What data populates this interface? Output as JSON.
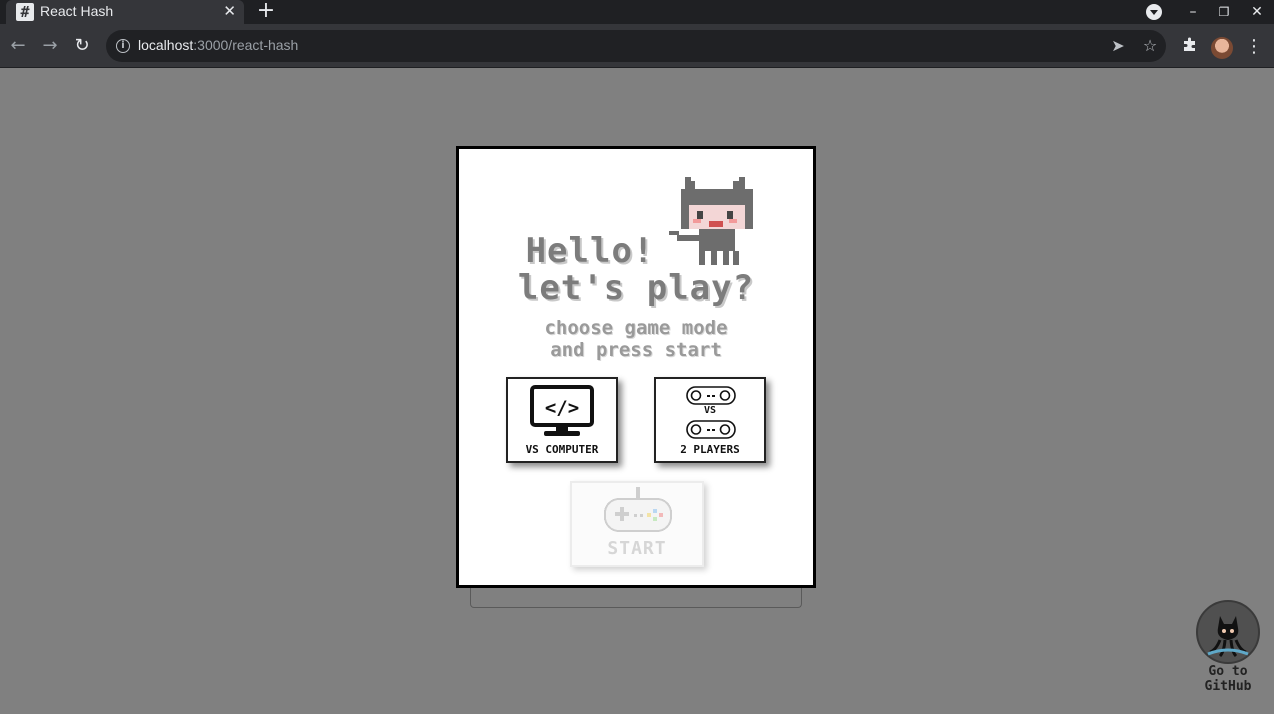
{
  "browser": {
    "tab_title": "React Hash",
    "favicon_glyph": "#",
    "close_glyph": "✕",
    "new_tab_glyph": "+",
    "url_host": "localhost",
    "url_path": ":3000/react-hash"
  },
  "page": {
    "heading_line1": "Hello!",
    "heading_line2": "let's play?",
    "subtitle_line1": "choose game mode",
    "subtitle_line2": "and press start",
    "modes": [
      {
        "label": "VS COMPUTER",
        "icon": "monitor-code-icon"
      },
      {
        "label": "2 PLAYERS",
        "icon": "two-gamepads-icon",
        "vs_text": "VS"
      }
    ],
    "start_label": "START",
    "start_enabled": false,
    "github_line1": "Go to",
    "github_line2": "GitHub"
  },
  "colors": {
    "page_bg": "#808080",
    "card_bg": "#ffffff",
    "heading": "#7c7c7c",
    "subtitle": "#9a9a9a",
    "start_disabled": "#d6d6d6"
  }
}
